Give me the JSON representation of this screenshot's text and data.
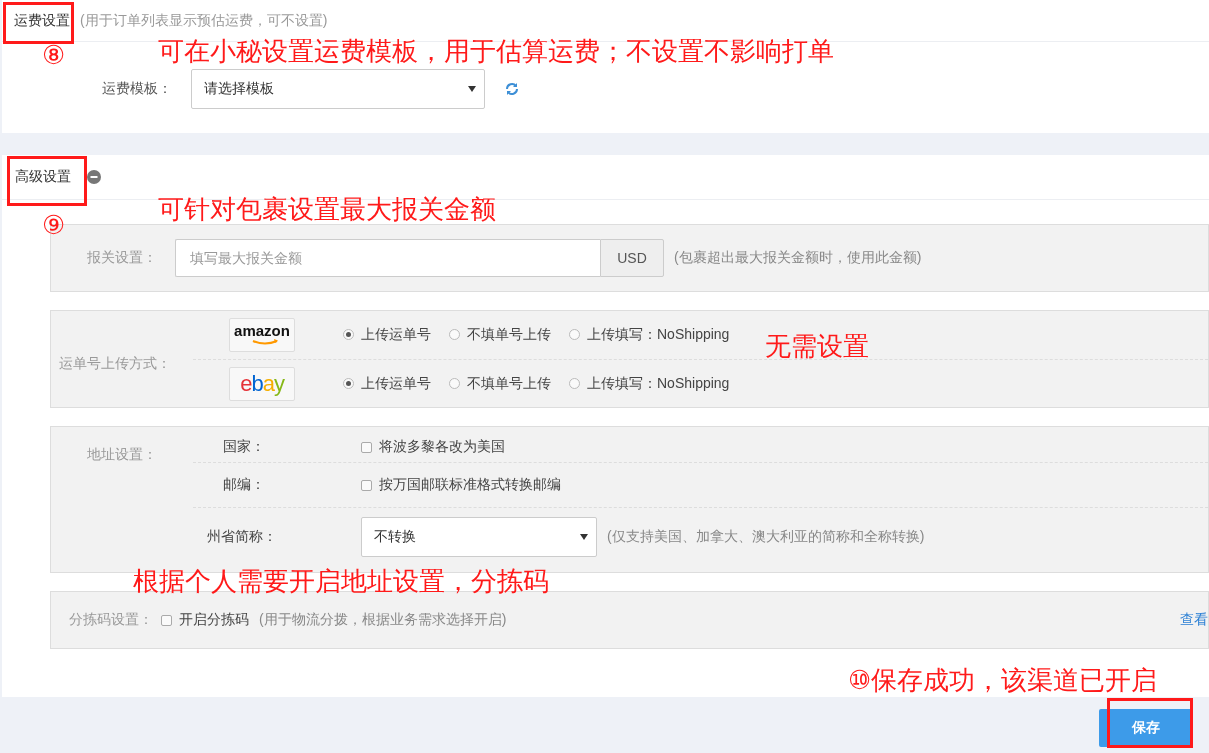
{
  "freight": {
    "title": "运费设置",
    "hint": "(用于订单列表显示预估运费，可不设置)",
    "template": {
      "label": "运费模板：",
      "value": "请选择模板"
    }
  },
  "advanced": {
    "title": "高级设置",
    "expanded": true,
    "customs": {
      "label": "报关设置：",
      "placeholder": "填写最大报关金额",
      "unit": "USD",
      "hint": "(包裹超出最大报关金额时，使用此金额)"
    },
    "upload": {
      "label": "运单号上传方式：",
      "platforms": [
        {
          "logo": "amazon",
          "options": [
            {
              "label": "上传运单号",
              "selected": true
            },
            {
              "label": "不填单号上传",
              "selected": false
            },
            {
              "label": "上传填写：NoShipping",
              "selected": false
            }
          ]
        },
        {
          "logo": "ebay",
          "options": [
            {
              "label": "上传运单号",
              "selected": true
            },
            {
              "label": "不填单号上传",
              "selected": false
            },
            {
              "label": "上传填写：NoShipping",
              "selected": false
            }
          ]
        }
      ]
    },
    "address": {
      "label": "地址设置：",
      "rows": [
        {
          "kind": "checkbox",
          "label": "国家：",
          "option": "将波多黎各改为美国",
          "checked": false
        },
        {
          "kind": "checkbox",
          "label": "邮编：",
          "option": "按万国邮联标准格式转换邮编",
          "checked": false
        },
        {
          "kind": "select",
          "label": "州省简称：",
          "value": "不转换",
          "hint": "(仅支持美国、加拿大、澳大利亚的简称和全称转换)"
        }
      ]
    },
    "sorting": {
      "label": "分拣码设置：",
      "option": "开启分拣码",
      "checked": false,
      "hint": "(用于物流分拨，根据业务需求选择开启)",
      "link": "查看"
    }
  },
  "save": "保存",
  "annotations": [
    "⑧",
    "可在小秘设置运费模板，用于估算运费；不设置不影响打单",
    "⑨",
    "可针对包裹设置最大报关金额",
    "无需设置",
    "根据个人需要开启地址设置，分拣码",
    "⑩保存成功，该渠道已开启"
  ]
}
